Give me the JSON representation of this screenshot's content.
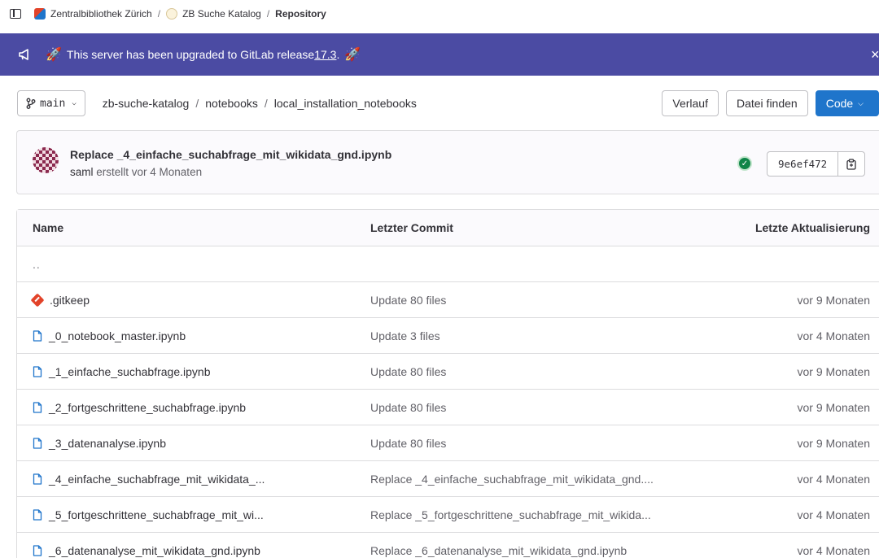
{
  "breadcrumb": {
    "items": [
      {
        "label": "Zentralbibliothek Zürich"
      },
      {
        "label": "ZB Suche Katalog"
      },
      {
        "label": "Repository"
      }
    ],
    "separator": "/"
  },
  "banner": {
    "text_before": "This server has been upgraded to GitLab release ",
    "link_text": "17.3",
    "text_after": ".",
    "close_glyph": "×",
    "bg_color": "#4b4ba3"
  },
  "repo_nav": {
    "branch": "main",
    "path": [
      "zb-suche-katalog",
      "notebooks",
      "local_installation_notebooks"
    ],
    "path_separator": "/",
    "history_button": "Verlauf",
    "find_file_button": "Datei finden",
    "code_button": "Code"
  },
  "last_commit": {
    "title": "Replace _4_einfache_suchabfrage_mit_wikidata_gnd.ipynb",
    "author": "saml",
    "meta_text": " erstellt vor 4 Monaten",
    "sha": "9e6ef472",
    "pipeline_status": "success"
  },
  "file_table": {
    "headers": {
      "name": "Name",
      "commit": "Letzter Commit",
      "updated": "Letzte Aktualisierung"
    },
    "parent_dir": "..",
    "rows": [
      {
        "name": ".gitkeep",
        "type": "gitkeep",
        "commit": "Update 80 files",
        "updated": "vor 9 Monaten"
      },
      {
        "name": "_0_notebook_master.ipynb",
        "type": "file",
        "commit": "Update 3 files",
        "updated": "vor 4 Monaten"
      },
      {
        "name": "_1_einfache_suchabfrage.ipynb",
        "type": "file",
        "commit": "Update 80 files",
        "updated": "vor 9 Monaten"
      },
      {
        "name": "_2_fortgeschrittene_suchabfrage.ipynb",
        "type": "file",
        "commit": "Update 80 files",
        "updated": "vor 9 Monaten"
      },
      {
        "name": "_3_datenanalyse.ipynb",
        "type": "file",
        "commit": "Update 80 files",
        "updated": "vor 9 Monaten"
      },
      {
        "name": "_4_einfache_suchabfrage_mit_wikidata_...",
        "type": "file",
        "commit": "Replace _4_einfache_suchabfrage_mit_wikidata_gnd....",
        "updated": "vor 4 Monaten"
      },
      {
        "name": "_5_fortgeschrittene_suchabfrage_mit_wi...",
        "type": "file",
        "commit": "Replace _5_fortgeschrittene_suchabfrage_mit_wikida...",
        "updated": "vor 4 Monaten"
      },
      {
        "name": "_6_datenanalyse_mit_wikidata_gnd.ipynb",
        "type": "file",
        "commit": "Replace _6_datenanalyse_mit_wikidata_gnd.ipynb",
        "updated": "vor 4 Monaten"
      }
    ]
  },
  "colors": {
    "primary": "#1f75cb",
    "success": "#108548",
    "file_icon": "#1f75cb",
    "gitkeep_icon": "#e24329"
  },
  "icons": {
    "sidebar": "sidebar-toggle-icon",
    "banner": "megaphone-icon",
    "rocket": "rocket-icon",
    "branch": "branch-icon",
    "file": "file-icon",
    "copy": "copy-icon",
    "pipeline": "status-success-icon"
  }
}
